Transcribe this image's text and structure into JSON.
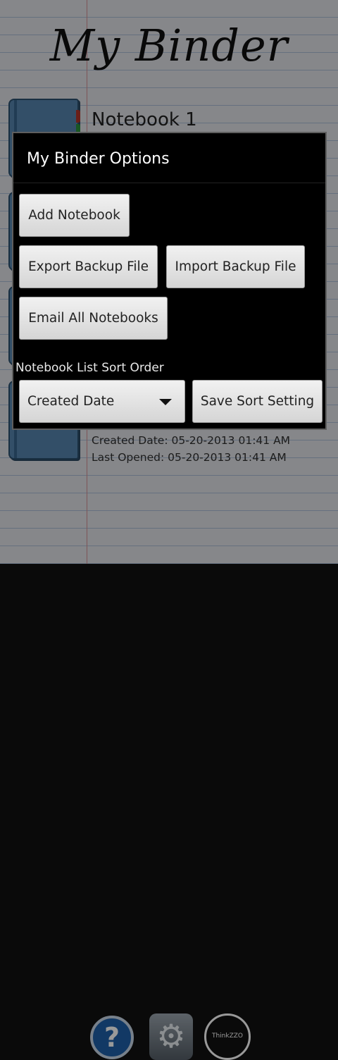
{
  "app": {
    "title": "My Binder",
    "notebook": {
      "name": "Notebook 1",
      "created": "Created Date: 05-20-2013 01:41 AM",
      "last_opened": "Last Opened: 05-20-2013 01:41 AM"
    },
    "bottom_bar": {
      "help_icon": "?",
      "settings_icon": "⚙",
      "brand_label": "ThinkZZO"
    }
  },
  "dialog": {
    "title": "My Binder Options",
    "buttons": {
      "add_notebook": "Add Notebook",
      "export_backup": "Export Backup File",
      "import_backup": "Import Backup File",
      "email_all": "Email All Notebooks",
      "save_sort": "Save Sort Setting"
    },
    "sort_label": "Notebook List Sort Order",
    "sort_selected": "Created Date"
  },
  "colors": {
    "dialog_bg": "#000000",
    "button_bg": "#e3e3e3",
    "notebook_cover": "#5d8fbd"
  }
}
